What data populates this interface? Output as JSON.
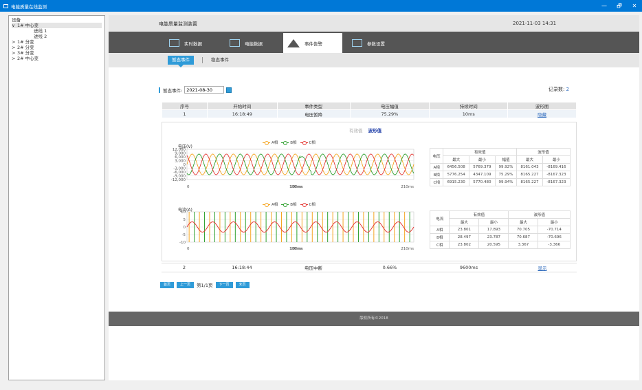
{
  "window": {
    "title": "电能质量在线监测",
    "minimize": "—",
    "maximize": "🗗",
    "close": "✕"
  },
  "tree": {
    "header": "设备",
    "items": [
      {
        "label": "1# 中心变",
        "expander": "∨",
        "level": 1,
        "selected": true
      },
      {
        "label": "进线 1",
        "expander": "",
        "level": 2,
        "selected": false
      },
      {
        "label": "进线 2",
        "expander": "",
        "level": 2,
        "selected": false
      },
      {
        "label": "1# 分变",
        "expander": ">",
        "level": 1,
        "selected": false
      },
      {
        "label": "2# 分变",
        "expander": ">",
        "level": 1,
        "selected": false
      },
      {
        "label": "3# 分变",
        "expander": ">",
        "level": 1,
        "selected": false
      },
      {
        "label": "2# 中心变",
        "expander": ">",
        "level": 1,
        "selected": false
      }
    ]
  },
  "header": {
    "title": "电能质量监测装置",
    "datetime": "2021-11-03 14:31"
  },
  "nav": {
    "tabs": [
      {
        "label": "实时数据",
        "icon": "realtime-monitor-icon",
        "active": false
      },
      {
        "label": "电能数据",
        "icon": "monitor-icon",
        "active": false
      },
      {
        "label": "事件告警",
        "icon": "warning-icon",
        "active": true
      },
      {
        "label": "参数设置",
        "icon": "settings-monitor-icon",
        "active": false
      }
    ]
  },
  "subnav": {
    "tabs": [
      {
        "label": "暂态事件",
        "active": true
      },
      {
        "label": "稳态事件",
        "active": false
      }
    ]
  },
  "filter": {
    "label": "暂态事件:",
    "date": "2021-08-30"
  },
  "record_count": {
    "label": "记录数:",
    "value": "2"
  },
  "events": {
    "columns": [
      "序号",
      "开始时间",
      "事件类型",
      "电压幅值",
      "持续时间",
      "波形图"
    ],
    "rows": [
      {
        "no": "1",
        "start": "16:18:49",
        "type": "电压暂降",
        "amplitude": "75.29%",
        "duration": "10ms",
        "action": "隐藏"
      },
      {
        "no": "2",
        "start": "16:18:44",
        "type": "电压中断",
        "amplitude": "0.66%",
        "duration": "9600ms",
        "action": "显示"
      }
    ]
  },
  "waveform": {
    "switch": {
      "rms": "有效值",
      "wave": "波形值"
    },
    "phase_labels": [
      "A相",
      "B相",
      "C相"
    ],
    "phase_colors": [
      "#f5a623",
      "#2ea02e",
      "#e53935"
    ],
    "voltage_chart": {
      "ylabel": "电压(V)",
      "yticks": [
        "12,000",
        "9,000",
        "6,000",
        "3,000",
        "0",
        "-3,000",
        "-6,000",
        "-9,000",
        "-12,000"
      ],
      "xticks": [
        "0",
        "100ms",
        "210ms"
      ],
      "overlay": "100ms",
      "ylim": [
        -12000,
        12000
      ],
      "amplitude": 8165,
      "sag_amplitude": 6150,
      "sag_start_ms": 105,
      "sag_end_ms": 115,
      "cycles": 11
    },
    "current_chart": {
      "ylabel": "电流(A)",
      "yticks": [
        "10",
        "5",
        "0",
        "-5",
        "-10"
      ],
      "xticks": [
        "0",
        "100ms",
        "210ms"
      ],
      "overlay": "100ms",
      "ylim": [
        -10,
        10
      ]
    },
    "voltage_table": {
      "corner": "电压",
      "group_rms": "有效值",
      "group_wave": "波形值",
      "sub": [
        "最大",
        "最小",
        "幅值",
        "最大",
        "最小"
      ],
      "rows": [
        {
          "phase": "A相",
          "cells": [
            "6456.508",
            "5769.379",
            "99.92%",
            "8161.043",
            "-8169.416"
          ]
        },
        {
          "phase": "B相",
          "cells": [
            "5776.254",
            "4347.109",
            "75.29%",
            "8165.227",
            "-8167.323"
          ]
        },
        {
          "phase": "C相",
          "cells": [
            "6915.230",
            "5770.480",
            "99.94%",
            "8165.227",
            "-8167.323"
          ]
        }
      ]
    },
    "current_table": {
      "corner": "电流",
      "group_rms": "有效值",
      "group_wave": "波形值",
      "sub": [
        "最大",
        "最小",
        "最大",
        "最小"
      ],
      "rows": [
        {
          "phase": "A相",
          "cells": [
            "23.801",
            "17.893",
            "70.705",
            "-70.714"
          ]
        },
        {
          "phase": "B相",
          "cells": [
            "28.497",
            "23.787",
            "70.687",
            "-70.696"
          ]
        },
        {
          "phase": "C相",
          "cells": [
            "23.802",
            "20.595",
            "3.367",
            "-3.366"
          ]
        }
      ]
    }
  },
  "pager": {
    "first": "首页",
    "prev": "上一页",
    "page_text": "第1/1页",
    "next": "下一页",
    "last": "末页"
  },
  "footer": {
    "text": "版权所有©2018"
  }
}
